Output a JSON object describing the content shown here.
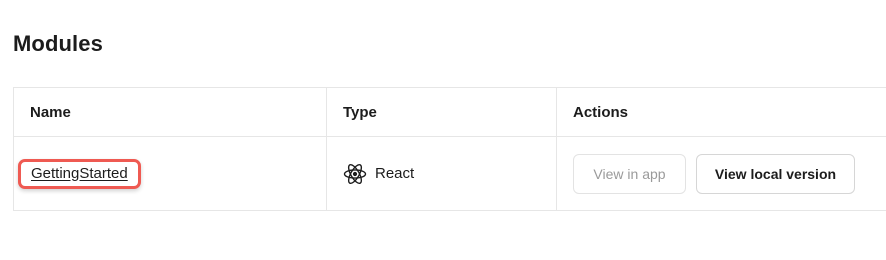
{
  "page": {
    "title": "Modules"
  },
  "table": {
    "headers": {
      "name": "Name",
      "type": "Type",
      "actions": "Actions"
    },
    "rows": [
      {
        "name": "GettingStarted",
        "type": "React",
        "type_icon": "react-icon",
        "actions": {
          "view_in_app": "View in app",
          "view_local": "View local version"
        }
      }
    ]
  },
  "colors": {
    "highlight_border": "#ef5a52",
    "disabled_text": "#9a9a9a",
    "border": "#e6e6e6"
  }
}
